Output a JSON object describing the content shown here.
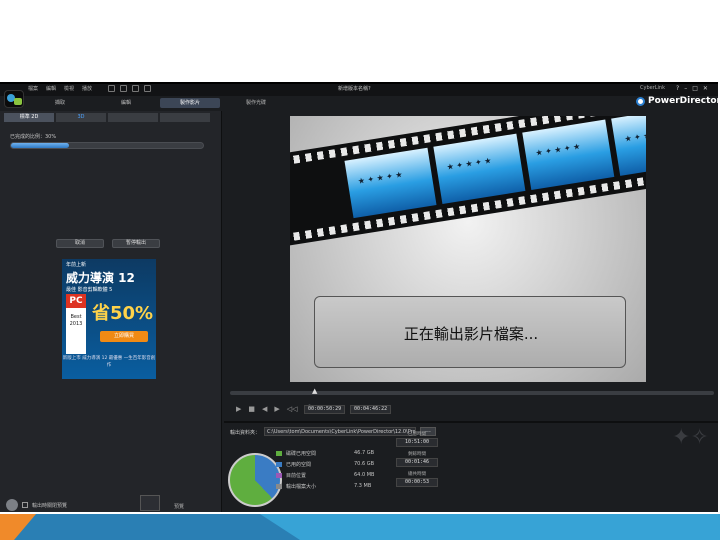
{
  "window": {
    "title": "新增版本名稱?",
    "menu": [
      "檔案",
      "編輯",
      "檢視",
      "播放"
    ],
    "brand_small": "CyberLink",
    "controls": [
      "?",
      "–",
      "□",
      "✕"
    ],
    "product": "PowerDirector"
  },
  "mode_tabs": [
    "擷取",
    "編輯",
    "製作影片",
    "製作光碟"
  ],
  "mode_active": "製作影片",
  "left": {
    "subtabs": [
      "標準 2D",
      "3D",
      "",
      ""
    ],
    "progress_label": "已完成的比例：30%",
    "progress": 0.3,
    "buttons": {
      "cancel": "取消",
      "pause": "暫停輸出"
    },
    "ad": {
      "top": "年前上新",
      "name": "威力導演 12",
      "sub": "最佳 影音剪輯軟體 5",
      "badge": "PC",
      "best": "Best 2013",
      "discount": "省50%",
      "buy": "立即購買",
      "footer": "新版上市 威力導演 12 最優惠 一生百年影音創作"
    },
    "status_label": "輸出時關閉預覽",
    "preview_label": "預覽"
  },
  "preview": {
    "dialog_text": "正在輸出影片檔案...",
    "timecode_current": "00:00:50:29",
    "timecode_total": "00:04:46:22",
    "controls": [
      "▶",
      "■",
      "◀",
      "▶",
      "◁◁",
      "🔊"
    ]
  },
  "output": {
    "path_label": "輸出資料夾：",
    "path": "C:\\Users\\tom\\Documents\\CyberLink\\PowerDirector\\12.0\\Pro",
    "browse": "...",
    "legend": [
      {
        "label": "磁碟已用空間",
        "value": "46.7 GB",
        "color": "#5fae3f"
      },
      {
        "label": "已用的空間",
        "value": "70.6 GB",
        "color": "#3a7cc4"
      },
      {
        "label": "目前位置",
        "value": "64.0 MB",
        "color": "#9b59b6"
      },
      {
        "label": "輸出檔案大小",
        "value": "7.3 MB",
        "color": "#8a8a8a"
      }
    ],
    "times": [
      {
        "label": "已用時間",
        "value": "10:51:00"
      },
      {
        "label": "剩餘時間",
        "value": "00:01:46"
      },
      {
        "label": "總共時間",
        "value": "00:00:53"
      }
    ]
  }
}
